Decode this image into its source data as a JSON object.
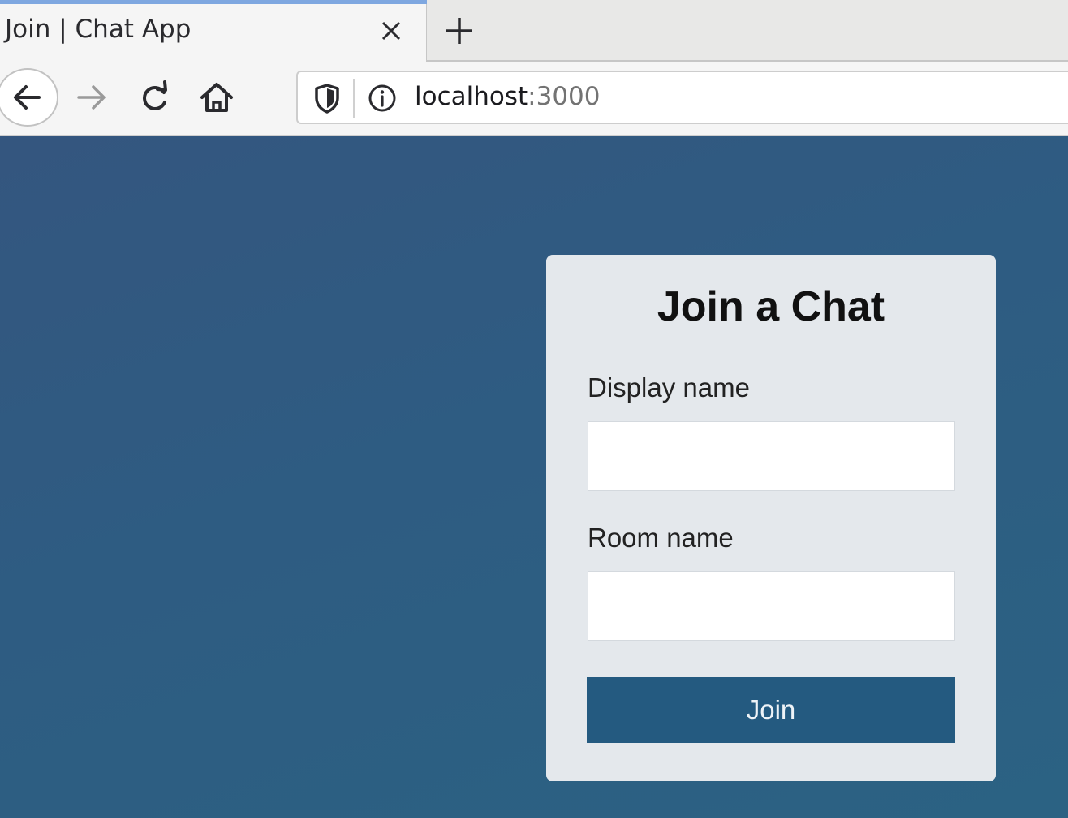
{
  "browser": {
    "tab": {
      "title": "Join | Chat App",
      "close_icon": "close-icon"
    },
    "new_tab_icon": "plus-icon",
    "nav": {
      "back_icon": "arrow-left-icon",
      "forward_icon": "arrow-right-icon",
      "reload_icon": "reload-icon",
      "home_icon": "home-icon"
    },
    "urlbar": {
      "shield_icon": "shield-icon",
      "info_icon": "info-icon",
      "host": "localhost",
      "port": ":3000"
    }
  },
  "page": {
    "background_colors": [
      "#34567f",
      "#2b6283"
    ],
    "card": {
      "title": "Join a Chat",
      "display_name": {
        "label": "Display name",
        "value": ""
      },
      "room_name": {
        "label": "Room name",
        "value": ""
      },
      "join_button": {
        "label": "Join",
        "color": "#245a80"
      }
    }
  }
}
